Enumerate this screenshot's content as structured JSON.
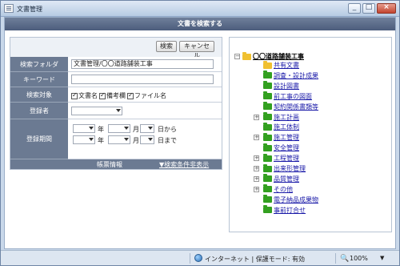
{
  "window": {
    "title": "文書管理",
    "minimize_icon": "minimize-icon",
    "maximize_icon": "maximize-icon",
    "close_icon": "close-icon"
  },
  "header": {
    "title": "文書を検索する"
  },
  "buttons": {
    "search": "検索",
    "cancel": "キャンセル"
  },
  "form": {
    "folder_label": "検索フォルダ",
    "folder_value": "文書管理/〇〇道路舗装工事",
    "keyword_label": "キーワード",
    "keyword_value": "",
    "target_label": "検索対象",
    "targets": [
      "文書名",
      "備考欄",
      "ファイル名"
    ],
    "registrant_label": "登録者",
    "registrant_value": "",
    "period_label": "登録期間",
    "year_unit": "年",
    "month_unit": "月",
    "day_from": "日から",
    "day_to": "日まで"
  },
  "footer": {
    "left": "帳票情報",
    "right": "▼検索条件非表示"
  },
  "tree": {
    "root": "〇〇道路舗装工事",
    "items": [
      {
        "label": "共有文書",
        "color": "yellow",
        "expandable": false
      },
      {
        "label": "調査・設計成果",
        "color": "green",
        "expandable": false
      },
      {
        "label": "設計図書",
        "color": "green",
        "expandable": false
      },
      {
        "label": "前工事の図面",
        "color": "green",
        "expandable": false
      },
      {
        "label": "契約関係書類等",
        "color": "green",
        "expandable": false
      },
      {
        "label": "施工計画",
        "color": "green",
        "expandable": true
      },
      {
        "label": "施工体制",
        "color": "green",
        "expandable": false
      },
      {
        "label": "施工管理",
        "color": "green",
        "expandable": true
      },
      {
        "label": "安全管理",
        "color": "green",
        "expandable": false
      },
      {
        "label": "工程管理",
        "color": "green",
        "expandable": true
      },
      {
        "label": "出来形管理",
        "color": "green",
        "expandable": true
      },
      {
        "label": "品質管理",
        "color": "green",
        "expandable": true
      },
      {
        "label": "その他",
        "color": "green",
        "expandable": true
      },
      {
        "label": "電子納品成果物",
        "color": "green",
        "expandable": false
      },
      {
        "label": "事前打合せ",
        "color": "green",
        "expandable": false
      }
    ]
  },
  "status": {
    "zone": "インターネット | 保護モード: 有効",
    "zoom": "100%"
  },
  "colors": {
    "header": "#5b6b88",
    "form_label": "#6b7a92",
    "folder_green": "#33a020",
    "folder_yellow": "#f0c030",
    "link": "#1a1aa8"
  }
}
